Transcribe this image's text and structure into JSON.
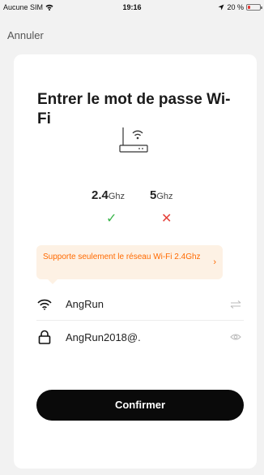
{
  "status_bar": {
    "carrier": "Aucune SIM",
    "time": "19:16",
    "battery": "20 %",
    "battery_level": 0.2
  },
  "nav": {
    "cancel_label": "Annuler"
  },
  "card": {
    "title": "Entrer le mot de passe Wi-Fi",
    "bands": [
      {
        "freq": "2.4",
        "unit": "Ghz",
        "supported": true
      },
      {
        "freq": "5",
        "unit": "Ghz",
        "supported": false
      }
    ],
    "notice": "Supporte seulement le réseau Wi-Fi 2.4Ghz",
    "wifi_name": "AngRun",
    "password": "AngRun2018@.",
    "confirm_label": "Confirmer"
  },
  "colors": {
    "accent_warning": "#ff6a00",
    "supported": "#39b54a",
    "unsupported": "#e5423b",
    "button": "#0a0a0a"
  },
  "icons": {
    "ssid": "wifi-icon",
    "password": "lock-icon",
    "switch_network": "switch-icon",
    "toggle_visibility": "eye-icon"
  }
}
